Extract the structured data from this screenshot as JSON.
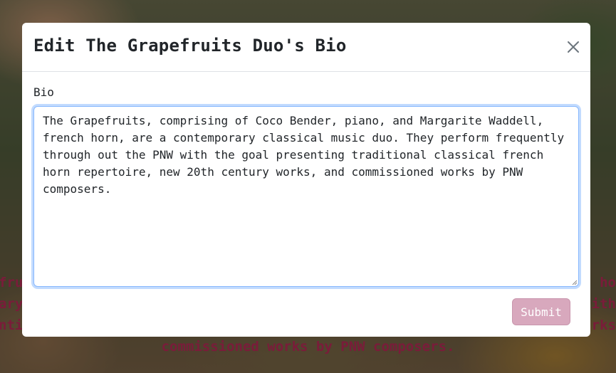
{
  "background": {
    "lines": [
      {
        "left": "fru",
        "right": "ho"
      },
      {
        "left": "ary",
        "right": "ith"
      },
      {
        "left": "nti",
        "right": "rks"
      },
      {
        "center": "commissioned works by PNW composers."
      }
    ]
  },
  "modal": {
    "title": "Edit The Grapefruits Duo's Bio",
    "close_label": "×",
    "bio_label": "Bio",
    "bio_value": "The Grapefruits, comprising of Coco Bender, piano, and Margarite Waddell, french horn, are a contemporary classical music duo. They perform frequently through out the PNW with the goal presenting traditional classical french horn repertoire, new 20th century works, and commissioned works by PNW composers.",
    "submit_label": "Submit"
  },
  "colors": {
    "accent": "#d8a8bd",
    "bg_text": "#7a1c3a",
    "focus_ring": "#86b7fe"
  }
}
